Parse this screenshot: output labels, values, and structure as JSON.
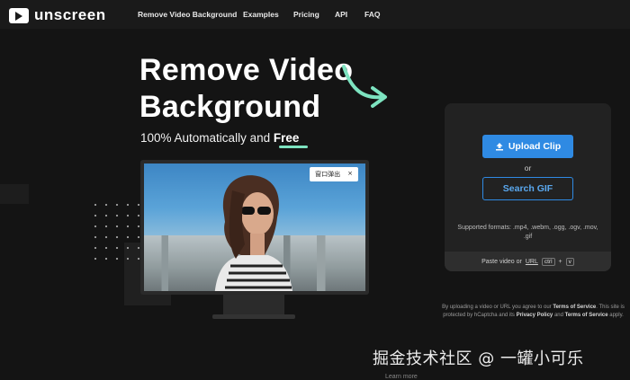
{
  "brand": {
    "name": "unscreen",
    "icon": "play-screen-icon"
  },
  "nav": {
    "items": [
      "Remove Video Background",
      "Examples",
      "Pricing",
      "API",
      "FAQ"
    ]
  },
  "hero": {
    "title": "Remove Video Background",
    "subtitle_prefix": "100% Automatically and ",
    "subtitle_emphasis": "Free",
    "accent_color": "#7de3c0"
  },
  "preview": {
    "popup_label": "窗口弹出",
    "popup_close": "×"
  },
  "upload_panel": {
    "upload_label": "Upload Clip",
    "upload_icon": "upload-icon",
    "or_text": "or",
    "search_gif_label": "Search GIF",
    "formats_text": "Supported formats: .mp4, .webm, .ogg, .ogv, .mov, .gif",
    "paste_prefix": "Paste video or",
    "paste_url": "URL",
    "kbd_ctrl": "ctrl",
    "kbd_plus": "+",
    "kbd_v": "v",
    "button_color": "#2f8ae3"
  },
  "terms": {
    "line1_prefix": "By uploading a video or URL you agree to our ",
    "tos": "Terms of Service",
    "line2_prefix": ". This site is protected by hCaptcha and its ",
    "privacy": "Privacy Policy",
    "and": " and ",
    "tos2": "Terms of Service",
    "apply": " apply."
  },
  "watermark": "掘金技术社区 @ 一罐小可乐",
  "learn_more": "Learn more"
}
